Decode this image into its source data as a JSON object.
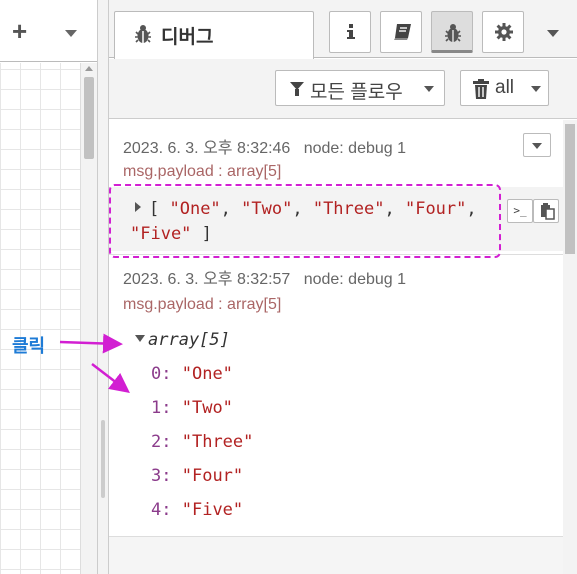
{
  "left_toolbar": {
    "add_glyph": "+",
    "menu_icon": "chevron-down-icon"
  },
  "sidebar_tabs": {
    "active_label": "디버그",
    "active_icon": "bug-icon",
    "buttons": [
      "info-icon",
      "book-icon",
      "bug-icon",
      "gear-icon"
    ],
    "overflow_icon": "chevron-down-icon"
  },
  "filter": {
    "label": "모든 플로우",
    "clear_label": "all"
  },
  "messages": [
    {
      "timestamp": "2023. 6. 3. 오후 8:32:46",
      "node": "node: debug 1",
      "topic": "msg.payload : array[5]",
      "open_bracket": "[ ",
      "items": [
        "\"One\"",
        "\"Two\"",
        "\"Three\"",
        "\"Four\"",
        "\"Five\""
      ],
      "close_bracket": " ]"
    },
    {
      "timestamp": "2023. 6. 3. 오후 8:32:57",
      "node": "node: debug 1",
      "topic": "msg.payload : array[5]",
      "array_label": "array[5]",
      "entries": [
        {
          "index": "0:",
          "value": "\"One\""
        },
        {
          "index": "1:",
          "value": "\"Two\""
        },
        {
          "index": "2:",
          "value": "\"Three\""
        },
        {
          "index": "3:",
          "value": "\"Four\""
        },
        {
          "index": "4:",
          "value": "\"Five\""
        }
      ]
    }
  ],
  "annotation": {
    "label": "클릭",
    "color": "#1e7bd6",
    "arrow_color": "#d21fd2"
  },
  "colors": {
    "highlight": "#d21fd2",
    "string": "#b22222",
    "topic": "#a66666",
    "index": "#8b3b8b"
  }
}
